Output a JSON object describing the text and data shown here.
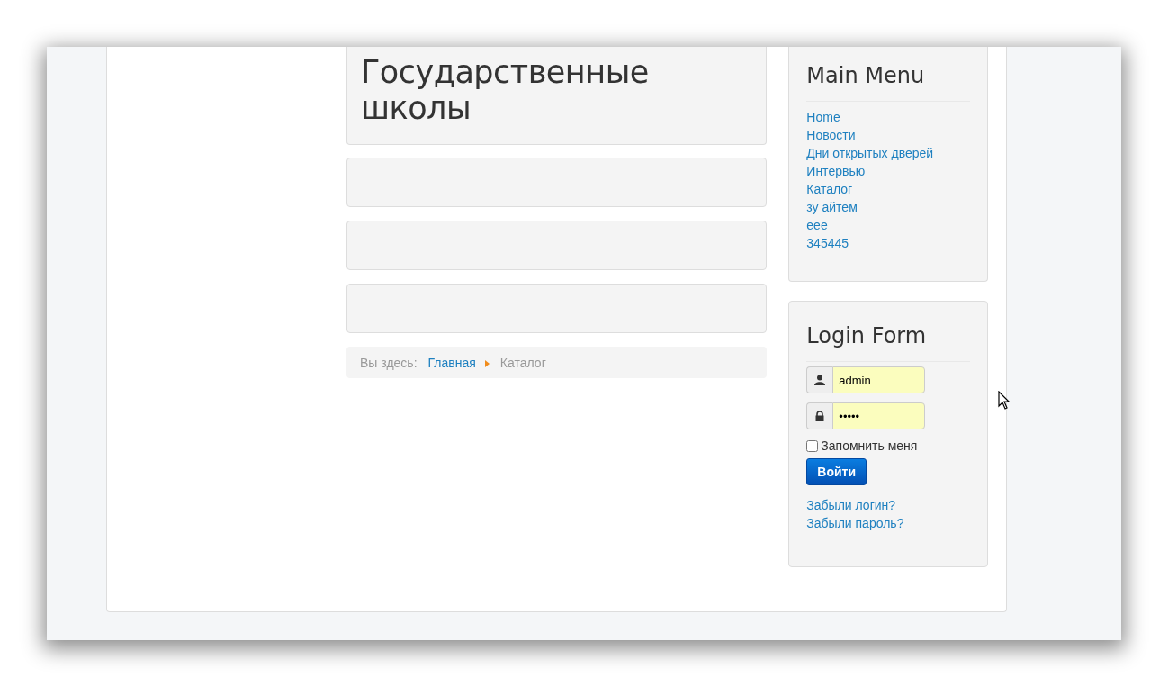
{
  "page_title": "Государственные школы",
  "articles": [
    {
      "kind": "empty"
    },
    {
      "kind": "empty"
    },
    {
      "kind": "empty"
    }
  ],
  "breadcrumb": {
    "label": "Вы здесь:",
    "items": [
      {
        "text": "Главная",
        "kind": "link"
      },
      {
        "text": "Каталог",
        "kind": "current"
      }
    ]
  },
  "main_menu": {
    "title": "Main Menu",
    "items": [
      "Home",
      "Новости",
      "Дни открытых дверей",
      "Интервью",
      "Каталог",
      "зу айтем",
      "eee",
      "345445"
    ]
  },
  "login_form": {
    "title": "Login Form",
    "username": {
      "value": "admin"
    },
    "password": {
      "value": "•••••"
    },
    "remember": {
      "label": "Запомнить меня",
      "checked": false
    },
    "submit": "Войти",
    "links": [
      "Забыли логин?",
      "Забыли пароль?"
    ]
  }
}
